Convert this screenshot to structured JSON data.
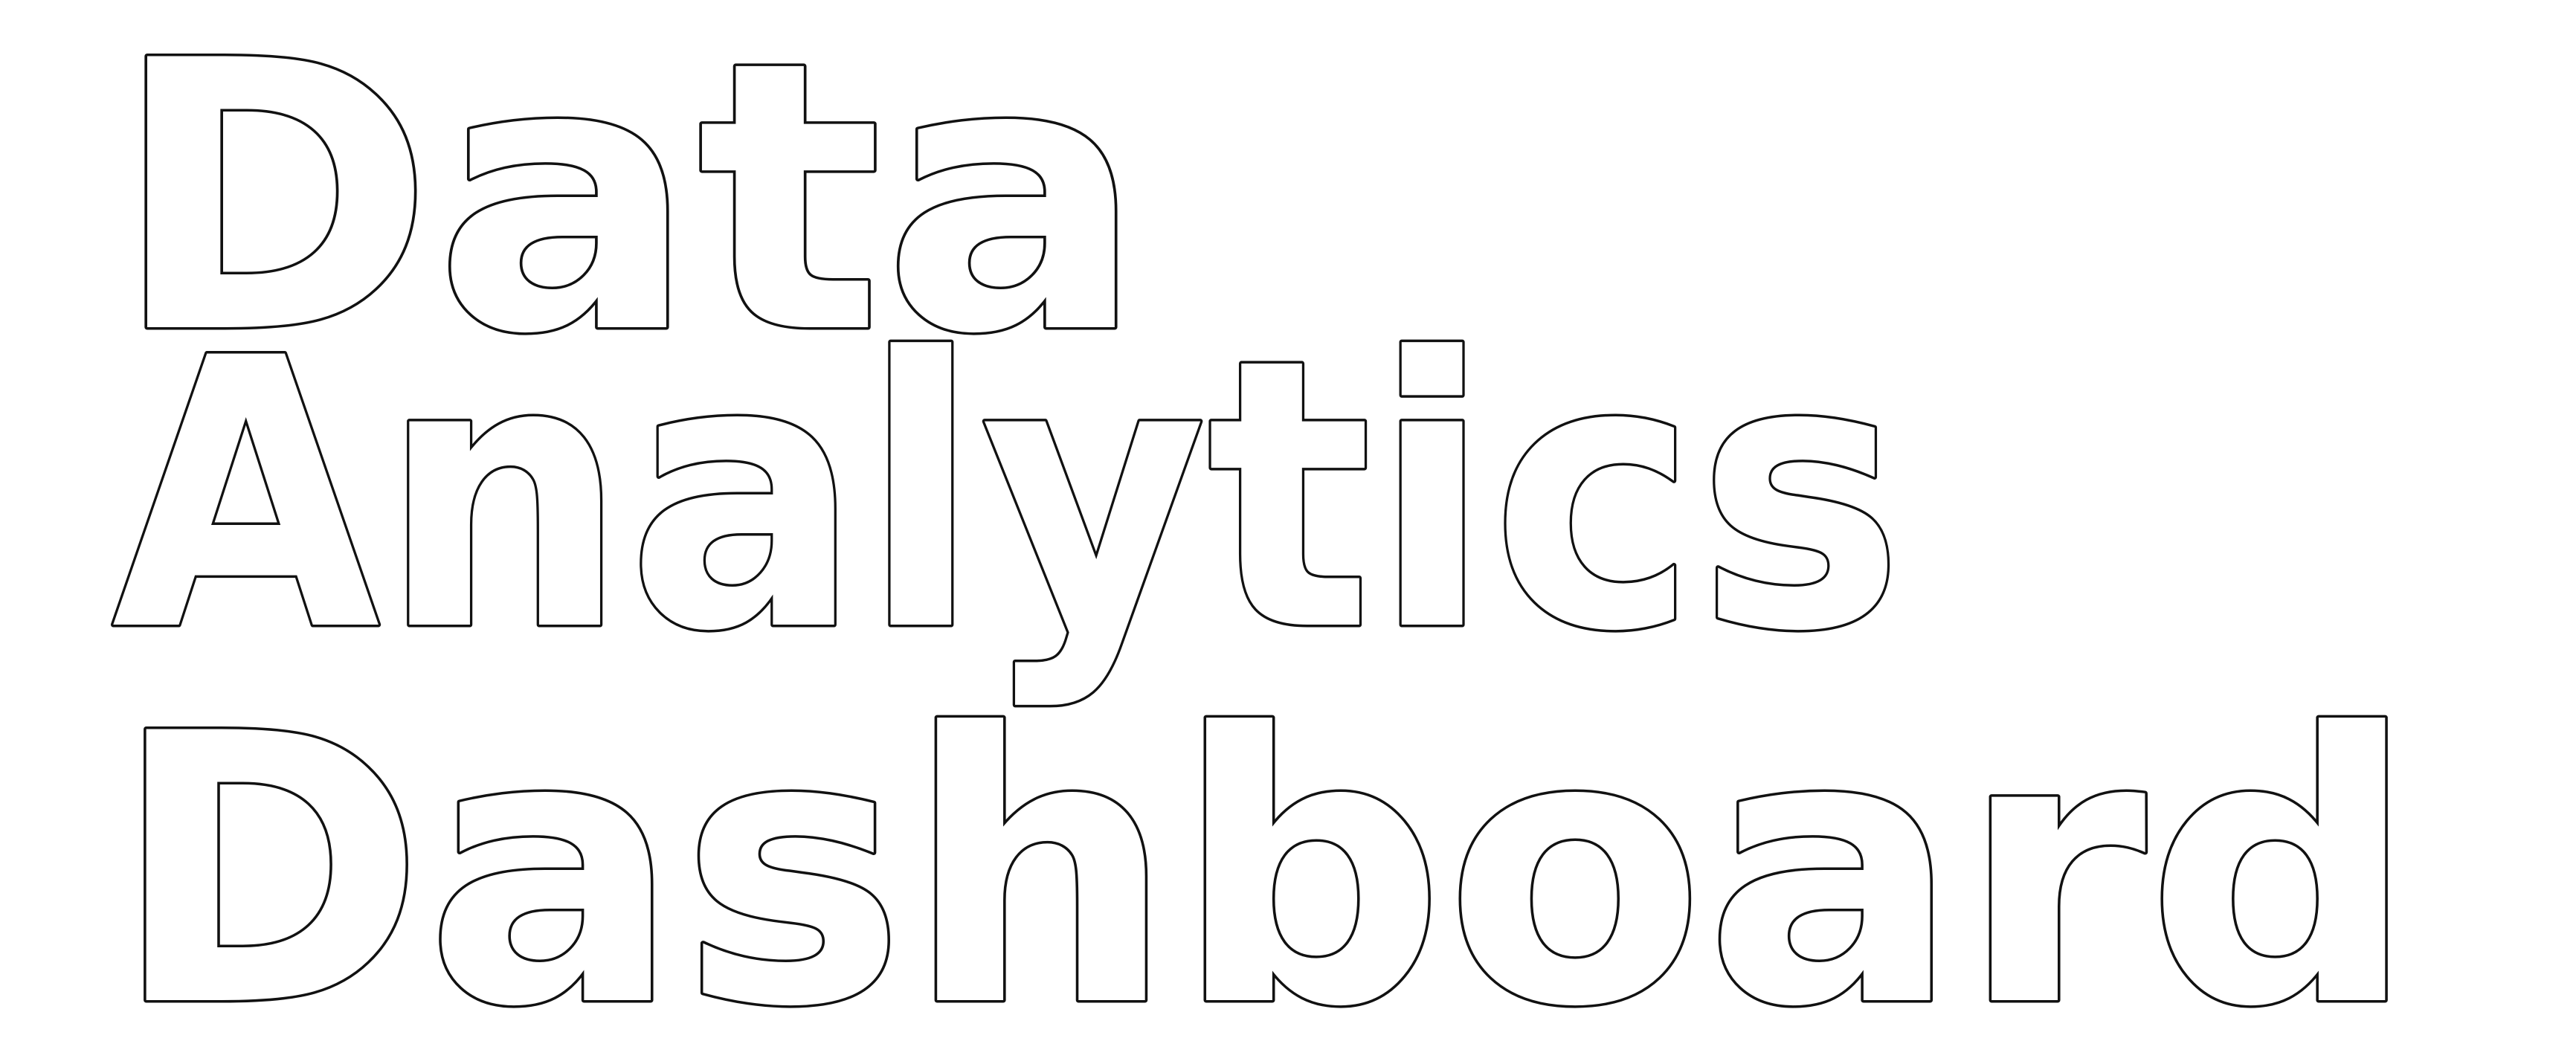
{
  "title": {
    "lines": [
      "Data",
      "Analytics",
      "Dashboard"
    ],
    "style": "outline",
    "fill_color": "#ffffff",
    "stroke_color": "#111111"
  },
  "background_color": "#ffffff"
}
